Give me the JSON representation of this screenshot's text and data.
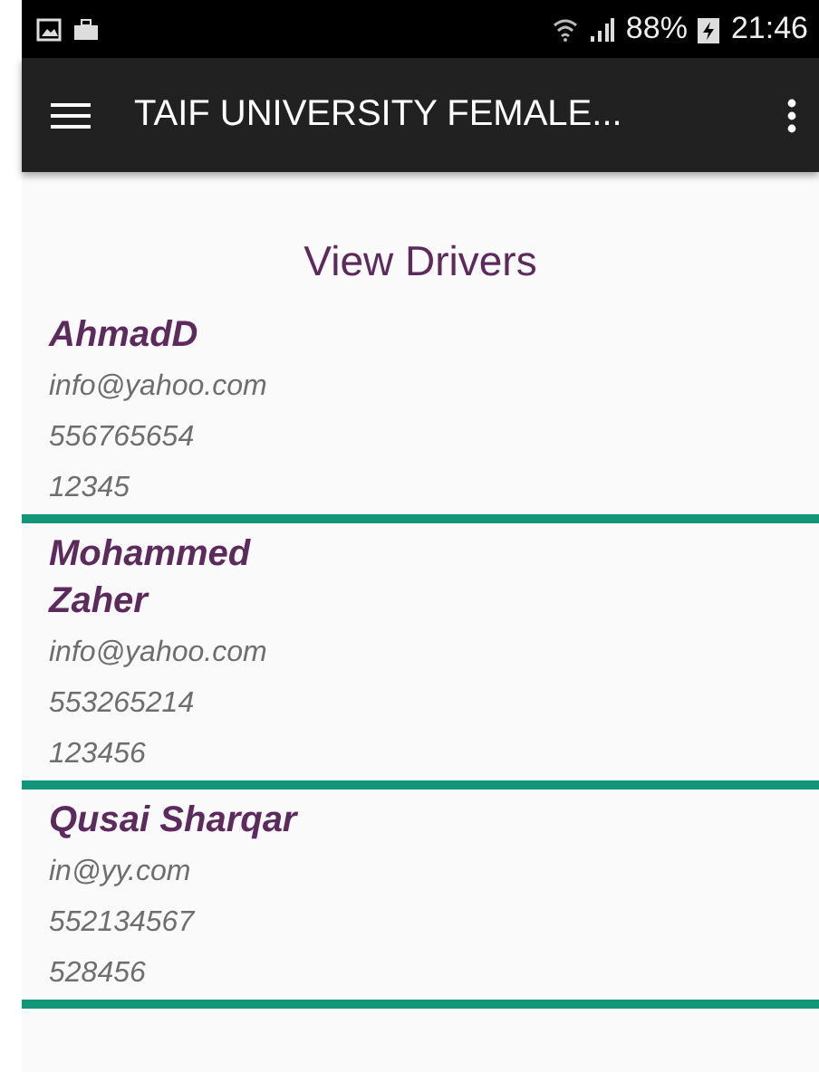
{
  "status_bar": {
    "battery": "88%",
    "time": "21:46"
  },
  "app_bar": {
    "title": "TAIF UNIVERSITY FEMALE..."
  },
  "page": {
    "heading": "View Drivers"
  },
  "drivers": [
    {
      "name": "AhmadD",
      "email": "info@yahoo.com",
      "phone": "556765654",
      "id": "12345"
    },
    {
      "name": "Mohammed Zaher",
      "email": "info@yahoo.com",
      "phone": "553265214",
      "id": "123456"
    },
    {
      "name": "Qusai Sharqar",
      "email": "in@yy.com",
      "phone": "552134567",
      "id": "528456"
    }
  ]
}
